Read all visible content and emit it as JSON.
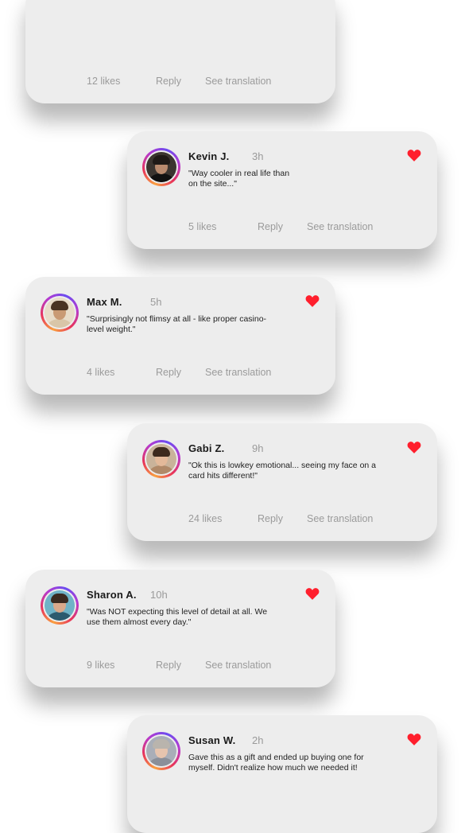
{
  "comments": [
    {
      "name": "",
      "time": "",
      "text": "",
      "likes": "12 likes",
      "reply": "Reply",
      "translate": "See translation",
      "liked": false,
      "avatar": {
        "bg": "#ffffff",
        "skin": "#ffffff",
        "hair": "#ffffff",
        "shirt": "#ffffff"
      }
    },
    {
      "name": "Kevin J.",
      "time": "3h",
      "text": "\"Way cooler in real life than on the site...\"",
      "likes": "5 likes",
      "reply": "Reply",
      "translate": "See translation",
      "liked": true,
      "avatar": {
        "bg": "#3b3530",
        "skin": "#b88a6e",
        "hair": "#1f1a17",
        "shirt": "#111111"
      }
    },
    {
      "name": "Max M.",
      "time": "5h",
      "text": "\"Surprisingly not flimsy at all - like proper casino-level weight.\"",
      "likes": "4 likes",
      "reply": "Reply",
      "translate": "See translation",
      "liked": true,
      "avatar": {
        "bg": "#e8dcc8",
        "skin": "#c99a73",
        "hair": "#4a3422",
        "shirt": "#d9c6a8"
      }
    },
    {
      "name": "Gabi Z.",
      "time": "9h",
      "text": "\"Ok this is lowkey emotional... seeing my face on a card hits different!\"",
      "likes": "24 likes",
      "reply": "Reply",
      "translate": "See translation",
      "liked": true,
      "avatar": {
        "bg": "#c9b39a",
        "skin": "#e3b999",
        "hair": "#3d2a1d",
        "shirt": "#b08968"
      }
    },
    {
      "name": "Sharon A.",
      "time": "10h",
      "text": "\"Was NOT expecting this level of detail at all. We use them almost every day.\"",
      "likes": "9 likes",
      "reply": "Reply",
      "translate": "See translation",
      "liked": true,
      "avatar": {
        "bg": "#6fb3c7",
        "skin": "#d9a98b",
        "hair": "#3a2a20",
        "shirt": "#2c5a6e"
      }
    },
    {
      "name": "Susan W.",
      "time": "2h",
      "text": "Gave this as a gift and ended up buying one for myself. Didn't realize how much we needed it!",
      "likes": "",
      "reply": "",
      "translate": "",
      "liked": true,
      "avatar": {
        "bg": "#a9aeb8",
        "skin": "#e6c4ae",
        "hair": "#b9b4ad",
        "shirt": "#8a8f99"
      }
    }
  ],
  "colors": {
    "heart": "#ff1f2d",
    "card": "#ededed",
    "muted": "#9b9b9b"
  }
}
